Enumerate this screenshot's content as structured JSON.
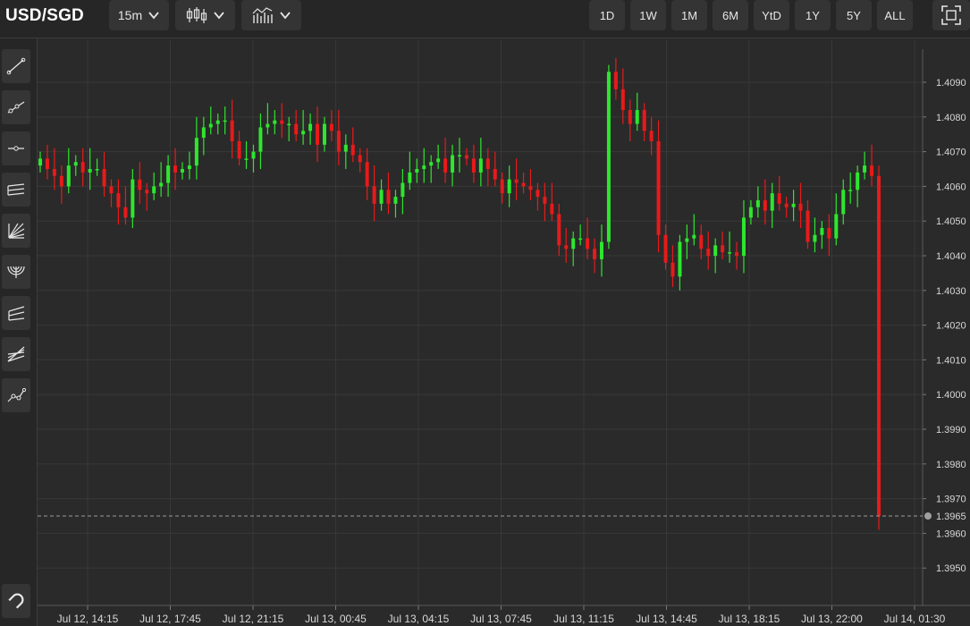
{
  "symbol": "USD/SGD",
  "toolbar": {
    "interval": "15m",
    "ranges": [
      "1D",
      "1W",
      "1M",
      "6M",
      "YtD",
      "1Y",
      "5Y",
      "ALL"
    ]
  },
  "sidebar_tools": [
    "trend-line-icon",
    "ray-icon",
    "horizontal-ray-icon",
    "parallel-channel-icon",
    "fib-fan-icon",
    "fib-arcs-icon",
    "pitchfork-icon",
    "gann-fan-icon",
    "path-icon"
  ],
  "magnet_tool": "magnet-icon",
  "colors": {
    "up": "#2ee62e",
    "down": "#e81a1a",
    "background": "#2a2a2a",
    "grid": "#383838"
  },
  "chart_data": {
    "type": "candlestick",
    "y_ticks": [
      "1.4090",
      "1.4080",
      "1.4070",
      "1.4060",
      "1.4050",
      "1.4040",
      "1.4030",
      "1.4020",
      "1.4010",
      "1.4000",
      "1.3990",
      "1.3980",
      "1.3970",
      "1.3960",
      "1.3950"
    ],
    "x_ticks": [
      "Jul 12, 14:15",
      "Jul 12, 17:45",
      "Jul 12, 21:15",
      "Jul 13, 00:45",
      "Jul 13, 04:15",
      "Jul 13, 07:45",
      "Jul 13, 11:15",
      "Jul 13, 14:45",
      "Jul 13, 18:15",
      "Jul 13, 22:00",
      "Jul 14, 01:30"
    ],
    "ylim": [
      1.3943,
      1.4099
    ],
    "current_price": "1.3965",
    "grid": true,
    "closes": [
      1.4068,
      1.4065,
      1.4063,
      1.406,
      1.4066,
      1.4067,
      1.4064,
      1.4065,
      1.4065,
      1.406,
      1.4058,
      1.4054,
      1.4051,
      1.4062,
      1.4059,
      1.4058,
      1.406,
      1.4061,
      1.4066,
      1.4064,
      1.4065,
      1.4066,
      1.4074,
      1.4077,
      1.4078,
      1.4079,
      1.4079,
      1.4073,
      1.4068,
      1.4068,
      1.407,
      1.4077,
      1.4078,
      1.4079,
      1.4078,
      1.4078,
      1.4075,
      1.4076,
      1.4078,
      1.4072,
      1.4078,
      1.4076,
      1.407,
      1.4072,
      1.4069,
      1.4067,
      1.406,
      1.4055,
      1.4059,
      1.4055,
      1.4057,
      1.4061,
      1.4064,
      1.4065,
      1.4066,
      1.4067,
      1.4068,
      1.4064,
      1.4069,
      1.4069,
      1.4068,
      1.4064,
      1.4068,
      1.4065,
      1.4062,
      1.4058,
      1.4062,
      1.4061,
      1.406,
      1.4059,
      1.4057,
      1.4055,
      1.4052,
      1.4043,
      1.4042,
      1.4045,
      1.4045,
      1.4042,
      1.4039,
      1.4044,
      1.4093,
      1.4088,
      1.4082,
      1.4078,
      1.4082,
      1.4076,
      1.4073,
      1.4046,
      1.4038,
      1.4034,
      1.4044,
      1.4045,
      1.4046,
      1.4042,
      1.404,
      1.4043,
      1.4041,
      1.4041,
      1.404,
      1.4051,
      1.4054,
      1.4056,
      1.4053,
      1.4058,
      1.4055,
      1.4054,
      1.4055,
      1.4053,
      1.4044,
      1.4046,
      1.4048,
      1.4045,
      1.4052,
      1.4059,
      1.4059,
      1.4064,
      1.4066,
      1.4063,
      1.3965
    ]
  }
}
